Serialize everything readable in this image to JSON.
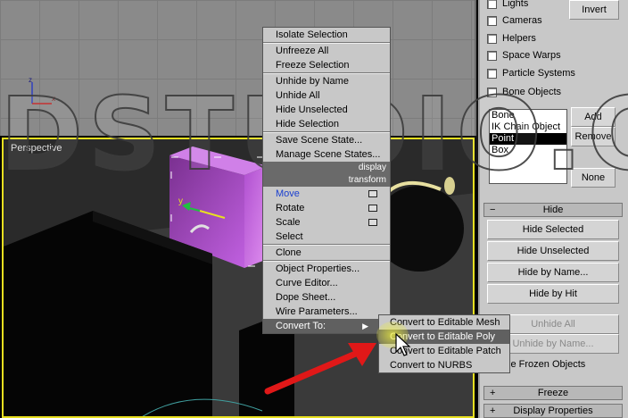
{
  "viewport": {
    "perspective_label": "Perspective"
  },
  "watermark": "DSTUDIO.COM",
  "panel": {
    "checkboxes": [
      {
        "label": "Lights"
      },
      {
        "label": "Cameras"
      },
      {
        "label": "Helpers"
      },
      {
        "label": "Space Warps"
      },
      {
        "label": "Particle Systems"
      },
      {
        "label": "Bone Objects"
      }
    ],
    "invert_label": "Invert",
    "list_items": [
      "Bone",
      "IK Chain Object",
      "Point",
      "Box"
    ],
    "list_selected": "Point",
    "add_label": "Add",
    "remove_label": "Remove",
    "none_label": "None",
    "hide_rollout": {
      "sign": "−",
      "label": "Hide"
    },
    "hide_selected": "Hide Selected",
    "hide_unselected": "Hide Unselected",
    "hide_by_name": "Hide by Name...",
    "hide_by_hit": "Hide by Hit",
    "unhide_all": "Unhide All",
    "unhide_by_name": "Unhide by Name...",
    "hide_frozen": "Hide Frozen Objects",
    "freeze_rollout": {
      "sign": "+",
      "label": "Freeze"
    },
    "display_props_rollout": {
      "sign": "+",
      "label": "Display Properties"
    }
  },
  "quad_menu": {
    "display_section": [
      "Isolate Selection",
      "Unfreeze All",
      "Freeze Selection",
      "Unhide by Name",
      "Unhide All",
      "Hide Unselected",
      "Hide Selection",
      "Save Scene State...",
      "Manage Scene States..."
    ],
    "display_header": "display",
    "transform_header": "transform",
    "transform_section": [
      "Move",
      "Rotate",
      "Scale",
      "Select",
      "Clone",
      "Object Properties...",
      "Curve Editor...",
      "Dope Sheet...",
      "Wire Parameters...",
      "Convert To:"
    ]
  },
  "submenu": {
    "items": [
      "Convert to Editable Mesh",
      "Convert to Editable Poly",
      "Convert to Editable Patch",
      "Convert to NURBS"
    ],
    "highlighted": "Convert to Editable Poly"
  },
  "axis_labels": {
    "z": "z",
    "x": "x",
    "y": "y"
  },
  "colors": {
    "viewport_border": "#e8e020",
    "box_purple": "#a040c0",
    "highlight": "#606060",
    "arrow": "#e01818"
  }
}
